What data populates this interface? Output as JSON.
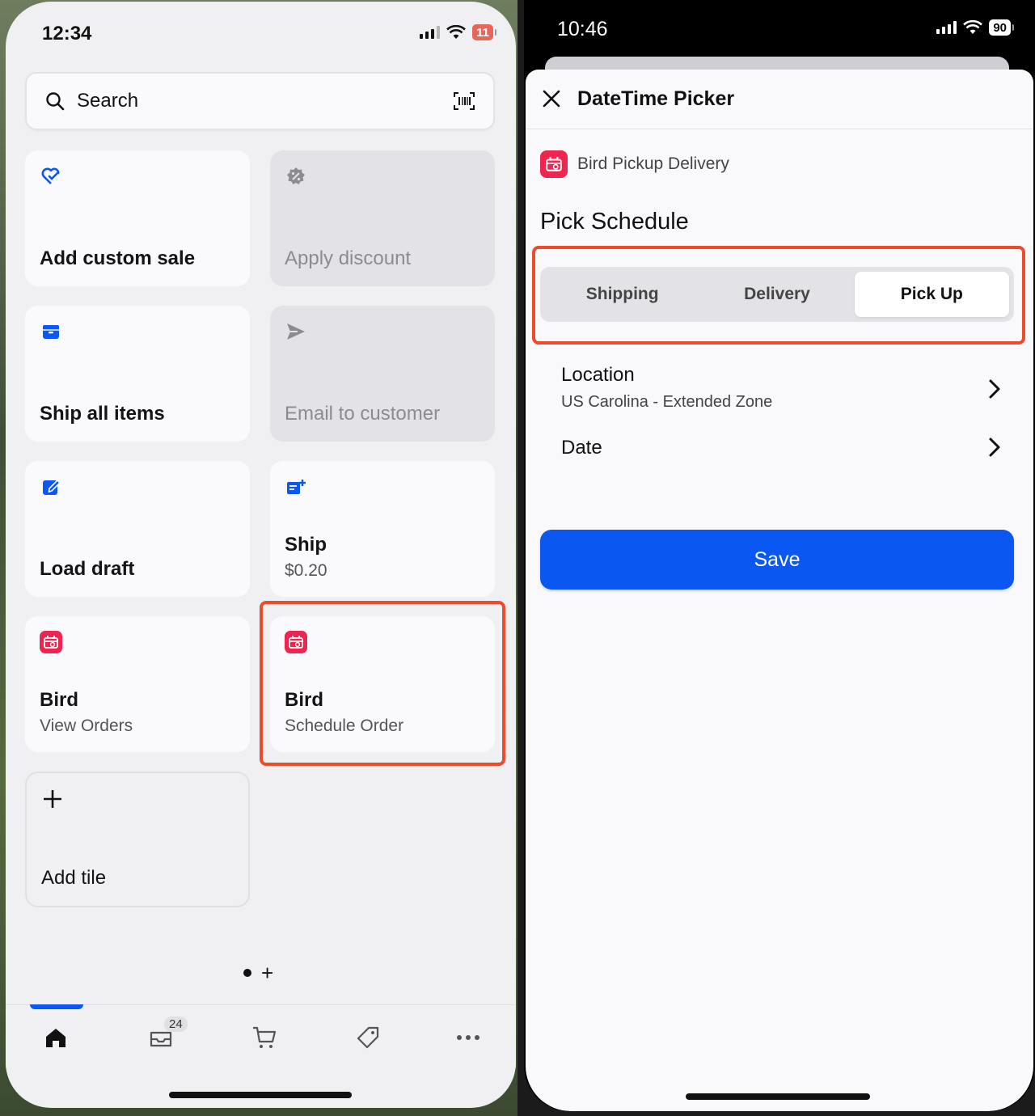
{
  "left_screen": {
    "status": {
      "time": "12:34",
      "battery": "11"
    },
    "search": {
      "placeholder": "Search"
    },
    "tiles": [
      {
        "title": "Add custom sale",
        "icon": "heart-check-icon",
        "disabled": false
      },
      {
        "title": "Apply discount",
        "icon": "discount-badge-icon",
        "disabled": true
      },
      {
        "title": "Ship all items",
        "icon": "package-icon",
        "disabled": false
      },
      {
        "title": "Email to customer",
        "icon": "send-icon",
        "disabled": true
      },
      {
        "title": "Load draft",
        "icon": "draft-edit-icon",
        "disabled": false
      },
      {
        "title": "Ship",
        "subtitle": "$0.20",
        "icon": "shipping-label-icon",
        "disabled": false
      },
      {
        "title": "Bird",
        "subtitle": "View Orders",
        "icon": "bird-app-icon",
        "disabled": false
      },
      {
        "title": "Bird",
        "subtitle": "Schedule Order",
        "icon": "bird-app-icon",
        "disabled": false,
        "highlighted": true
      },
      {
        "title": "Add tile",
        "icon": "plus-icon",
        "disabled": false
      }
    ],
    "page_indicator": {
      "add": "+"
    },
    "tabbar": {
      "items": [
        "home-icon",
        "inbox-icon",
        "cart-icon",
        "tag-icon",
        "more-icon"
      ],
      "inbox_badge": "24"
    },
    "colors": {
      "accent": "#0a57f2",
      "highlight": "#ee4b2b",
      "bird": "#f0254f"
    }
  },
  "right_screen": {
    "status": {
      "time": "10:46",
      "battery": "90"
    },
    "header": {
      "title": "DateTime Picker"
    },
    "app": {
      "name": "Bird Pickup Delivery"
    },
    "section_title": "Pick Schedule",
    "segments": [
      {
        "label": "Shipping",
        "active": false
      },
      {
        "label": "Delivery",
        "active": false
      },
      {
        "label": "Pick Up",
        "active": true
      }
    ],
    "location": {
      "label": "Location",
      "value": "US Carolina - Extended Zone"
    },
    "date": {
      "label": "Date"
    },
    "save_label": "Save"
  }
}
